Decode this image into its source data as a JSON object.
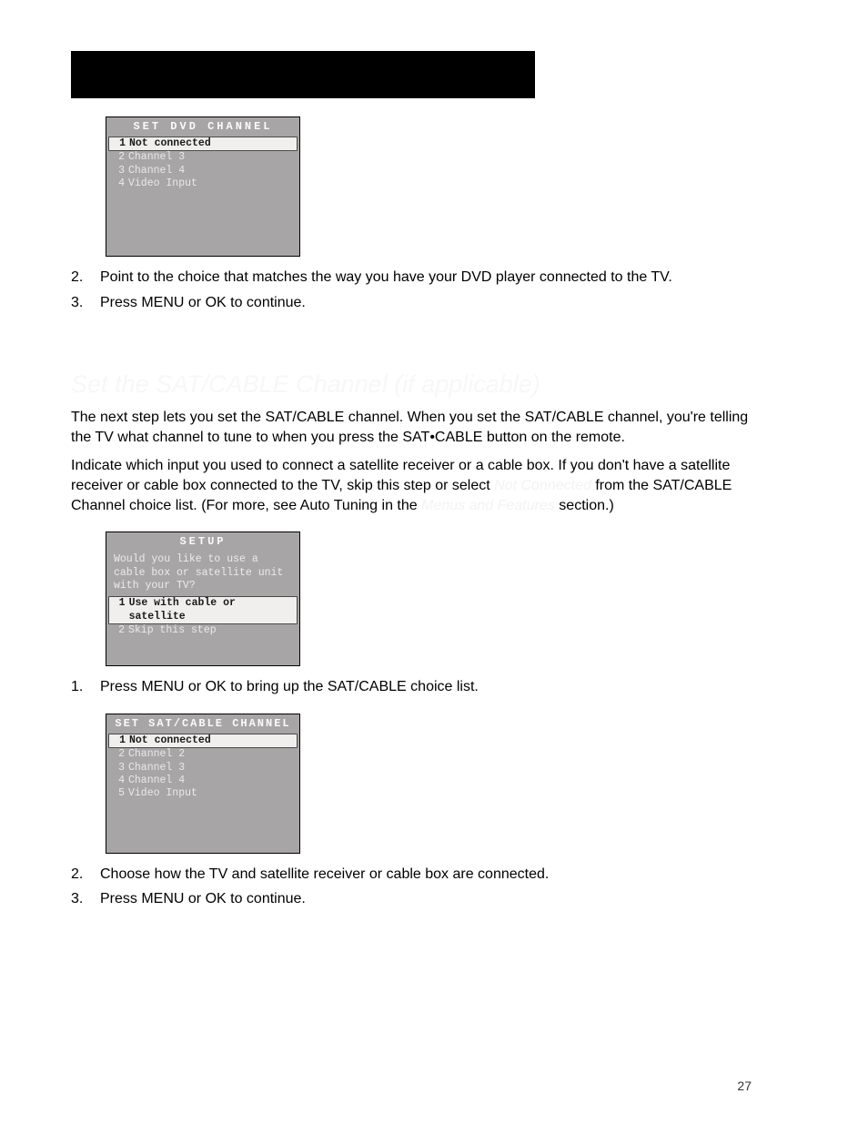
{
  "header": {
    "bar_text": ""
  },
  "page_number": "27",
  "menu1": {
    "title": "SET DVD CHANNEL",
    "rows": [
      {
        "num": "1",
        "label": "Not connected",
        "selected": true
      },
      {
        "num": "2",
        "label": "Channel 3",
        "selected": false
      },
      {
        "num": "3",
        "label": "Channel 4",
        "selected": false
      },
      {
        "num": "4",
        "label": "Video Input",
        "selected": false
      }
    ]
  },
  "steps_a": [
    {
      "n": "2.",
      "t": "Point to the choice that matches the way you have your DVD player connected to the TV."
    },
    {
      "n": "3.",
      "t": "Press MENU or OK to continue."
    }
  ],
  "section2_heading": "Set the SAT/CABLE Channel (if applicable)",
  "section2_para1": "The next step lets you set the SAT/CABLE channel. When you set the SAT/CABLE channel, you're telling the TV what channel to tune to when you press the SAT•CABLE button on the remote.",
  "section2_para2_a": "Indicate which input you used to connect a satellite receiver or a cable box. If you don't have a satellite receiver or cable box connected to the TV, skip this step or select ",
  "section2_para2_faint1": "Not Connected",
  "section2_para2_b": " from the SAT/CABLE Channel choice list. (For more, see Auto Tuning in the ",
  "section2_para2_faint2": "Menus and Features",
  "section2_para2_c": " section.)",
  "menu2": {
    "title": "SETUP",
    "question": "Would you like to use a cable box or satellite unit with your TV?",
    "rows": [
      {
        "num": "1",
        "label": "Use with cable or satellite",
        "selected": true
      },
      {
        "num": "2",
        "label": "Skip this step",
        "selected": false
      }
    ]
  },
  "steps_b1": [
    {
      "n": "1.",
      "t": "Press MENU or OK to bring up the SAT/CABLE choice list."
    }
  ],
  "menu3": {
    "title": "SET SAT/CABLE CHANNEL",
    "rows": [
      {
        "num": "1",
        "label": "Not connected",
        "selected": true
      },
      {
        "num": "2",
        "label": "Channel 2",
        "selected": false
      },
      {
        "num": "3",
        "label": "Channel 3",
        "selected": false
      },
      {
        "num": "4",
        "label": "Channel 4",
        "selected": false
      },
      {
        "num": "5",
        "label": "Video Input",
        "selected": false
      }
    ]
  },
  "steps_b2": [
    {
      "n": "2.",
      "t": "Choose how the TV and satellite receiver or cable box are connected."
    },
    {
      "n": "3.",
      "t": "Press MENU or OK to continue."
    }
  ]
}
